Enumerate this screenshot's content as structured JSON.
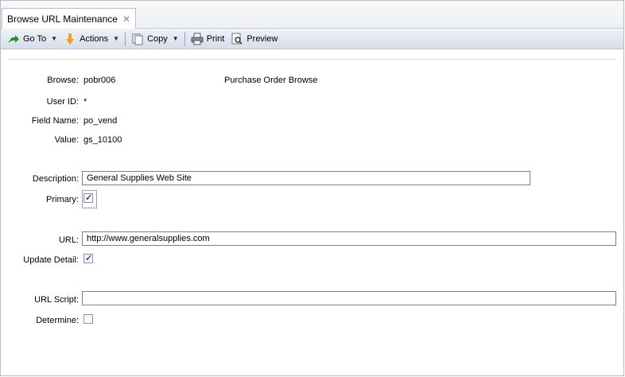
{
  "tab": {
    "title": "Browse URL Maintenance",
    "close": "✕"
  },
  "toolbar": {
    "goto": "Go To",
    "actions": "Actions",
    "copy": "Copy",
    "print": "Print",
    "preview": "Preview"
  },
  "form": {
    "browse_label": "Browse:",
    "browse_value": "pobr006",
    "browse_desc": "Purchase Order Browse",
    "userid_label": "User ID:",
    "userid_value": "*",
    "fieldname_label": "Field Name:",
    "fieldname_value": "po_vend",
    "value_label": "Value:",
    "value_value": "gs_10100",
    "description_label": "Description:",
    "description_value": "General Supplies Web Site",
    "primary_label": "Primary:",
    "primary_checked": true,
    "url_label": "URL:",
    "url_value": "http://www.generalsupplies.com",
    "update_label": "Update Detail:",
    "update_checked": true,
    "script_label": "URL Script:",
    "script_value": "",
    "determine_label": "Determine:",
    "determine_checked": false
  }
}
